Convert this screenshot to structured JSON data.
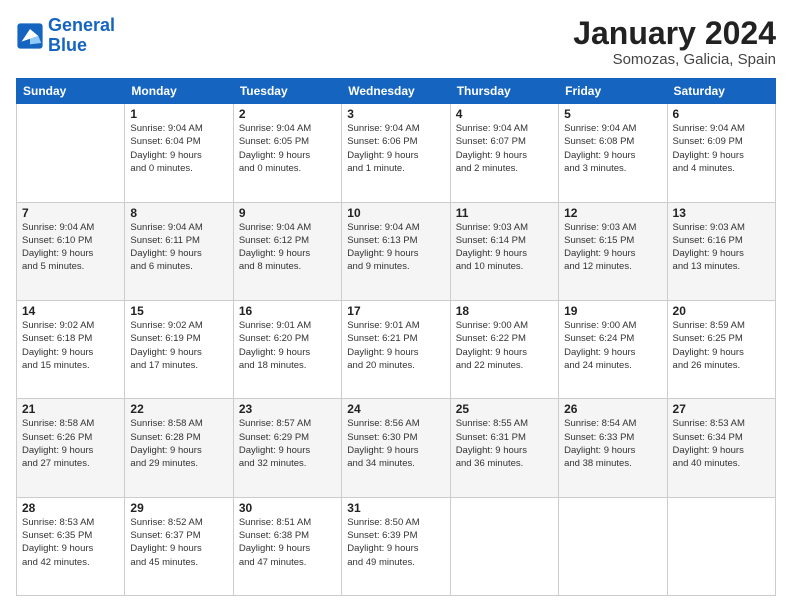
{
  "header": {
    "logo": {
      "line1": "General",
      "line2": "Blue"
    },
    "title": "January 2024",
    "subtitle": "Somozas, Galicia, Spain"
  },
  "columns": [
    "Sunday",
    "Monday",
    "Tuesday",
    "Wednesday",
    "Thursday",
    "Friday",
    "Saturday"
  ],
  "weeks": [
    [
      {
        "day": "",
        "info": ""
      },
      {
        "day": "1",
        "info": "Sunrise: 9:04 AM\nSunset: 6:04 PM\nDaylight: 9 hours\nand 0 minutes."
      },
      {
        "day": "2",
        "info": "Sunrise: 9:04 AM\nSunset: 6:05 PM\nDaylight: 9 hours\nand 0 minutes."
      },
      {
        "day": "3",
        "info": "Sunrise: 9:04 AM\nSunset: 6:06 PM\nDaylight: 9 hours\nand 1 minute."
      },
      {
        "day": "4",
        "info": "Sunrise: 9:04 AM\nSunset: 6:07 PM\nDaylight: 9 hours\nand 2 minutes."
      },
      {
        "day": "5",
        "info": "Sunrise: 9:04 AM\nSunset: 6:08 PM\nDaylight: 9 hours\nand 3 minutes."
      },
      {
        "day": "6",
        "info": "Sunrise: 9:04 AM\nSunset: 6:09 PM\nDaylight: 9 hours\nand 4 minutes."
      }
    ],
    [
      {
        "day": "7",
        "info": "Sunrise: 9:04 AM\nSunset: 6:10 PM\nDaylight: 9 hours\nand 5 minutes."
      },
      {
        "day": "8",
        "info": "Sunrise: 9:04 AM\nSunset: 6:11 PM\nDaylight: 9 hours\nand 6 minutes."
      },
      {
        "day": "9",
        "info": "Sunrise: 9:04 AM\nSunset: 6:12 PM\nDaylight: 9 hours\nand 8 minutes."
      },
      {
        "day": "10",
        "info": "Sunrise: 9:04 AM\nSunset: 6:13 PM\nDaylight: 9 hours\nand 9 minutes."
      },
      {
        "day": "11",
        "info": "Sunrise: 9:03 AM\nSunset: 6:14 PM\nDaylight: 9 hours\nand 10 minutes."
      },
      {
        "day": "12",
        "info": "Sunrise: 9:03 AM\nSunset: 6:15 PM\nDaylight: 9 hours\nand 12 minutes."
      },
      {
        "day": "13",
        "info": "Sunrise: 9:03 AM\nSunset: 6:16 PM\nDaylight: 9 hours\nand 13 minutes."
      }
    ],
    [
      {
        "day": "14",
        "info": "Sunrise: 9:02 AM\nSunset: 6:18 PM\nDaylight: 9 hours\nand 15 minutes."
      },
      {
        "day": "15",
        "info": "Sunrise: 9:02 AM\nSunset: 6:19 PM\nDaylight: 9 hours\nand 17 minutes."
      },
      {
        "day": "16",
        "info": "Sunrise: 9:01 AM\nSunset: 6:20 PM\nDaylight: 9 hours\nand 18 minutes."
      },
      {
        "day": "17",
        "info": "Sunrise: 9:01 AM\nSunset: 6:21 PM\nDaylight: 9 hours\nand 20 minutes."
      },
      {
        "day": "18",
        "info": "Sunrise: 9:00 AM\nSunset: 6:22 PM\nDaylight: 9 hours\nand 22 minutes."
      },
      {
        "day": "19",
        "info": "Sunrise: 9:00 AM\nSunset: 6:24 PM\nDaylight: 9 hours\nand 24 minutes."
      },
      {
        "day": "20",
        "info": "Sunrise: 8:59 AM\nSunset: 6:25 PM\nDaylight: 9 hours\nand 26 minutes."
      }
    ],
    [
      {
        "day": "21",
        "info": "Sunrise: 8:58 AM\nSunset: 6:26 PM\nDaylight: 9 hours\nand 27 minutes."
      },
      {
        "day": "22",
        "info": "Sunrise: 8:58 AM\nSunset: 6:28 PM\nDaylight: 9 hours\nand 29 minutes."
      },
      {
        "day": "23",
        "info": "Sunrise: 8:57 AM\nSunset: 6:29 PM\nDaylight: 9 hours\nand 32 minutes."
      },
      {
        "day": "24",
        "info": "Sunrise: 8:56 AM\nSunset: 6:30 PM\nDaylight: 9 hours\nand 34 minutes."
      },
      {
        "day": "25",
        "info": "Sunrise: 8:55 AM\nSunset: 6:31 PM\nDaylight: 9 hours\nand 36 minutes."
      },
      {
        "day": "26",
        "info": "Sunrise: 8:54 AM\nSunset: 6:33 PM\nDaylight: 9 hours\nand 38 minutes."
      },
      {
        "day": "27",
        "info": "Sunrise: 8:53 AM\nSunset: 6:34 PM\nDaylight: 9 hours\nand 40 minutes."
      }
    ],
    [
      {
        "day": "28",
        "info": "Sunrise: 8:53 AM\nSunset: 6:35 PM\nDaylight: 9 hours\nand 42 minutes."
      },
      {
        "day": "29",
        "info": "Sunrise: 8:52 AM\nSunset: 6:37 PM\nDaylight: 9 hours\nand 45 minutes."
      },
      {
        "day": "30",
        "info": "Sunrise: 8:51 AM\nSunset: 6:38 PM\nDaylight: 9 hours\nand 47 minutes."
      },
      {
        "day": "31",
        "info": "Sunrise: 8:50 AM\nSunset: 6:39 PM\nDaylight: 9 hours\nand 49 minutes."
      },
      {
        "day": "",
        "info": ""
      },
      {
        "day": "",
        "info": ""
      },
      {
        "day": "",
        "info": ""
      }
    ]
  ]
}
